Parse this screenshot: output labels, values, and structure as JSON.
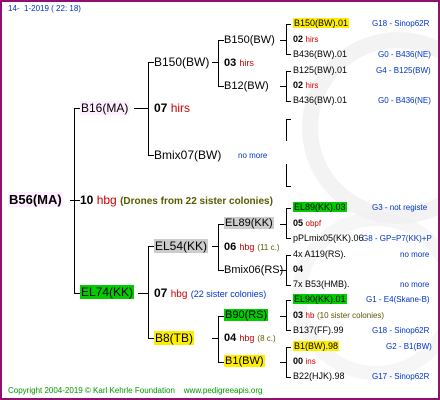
{
  "header": {
    "version": "14-",
    "date": "1-2019",
    "time": "( 22: 18)"
  },
  "root": {
    "name": "B56(MA)",
    "bg": "#ffeeff"
  },
  "gen1": {
    "top": {
      "name": "B16(MA)",
      "bg": "#ffeeff"
    },
    "queen_num": "10",
    "queen_code": "hbg",
    "drones_note": "(Drones from 22 sister colonies)",
    "bottom": {
      "name": "EL74(KK)",
      "bg": "#00cc00"
    }
  },
  "gen2": {
    "b16": {
      "name": "B150(BW)",
      "num": "07",
      "code": "hirs"
    },
    "b16_low": {
      "name": "Bmix07(BW)",
      "note": "no more"
    },
    "el74_top": {
      "name": "EL54(KK)",
      "bg": "#cccccc"
    },
    "el74": {
      "num": "07",
      "code": "hbg",
      "note": "(22 sister colonies)"
    },
    "el74_low": {
      "name": "B8(TB)",
      "bg": "#ffee00"
    }
  },
  "gen3": {
    "b150_top": {
      "name": "B150(BW)",
      "num": "03",
      "code": "hirs"
    },
    "b150_low": {
      "name": "B12(BW)"
    },
    "b12_top": {
      "name": "B125(BW)",
      "num": "02",
      "code": "hirs"
    },
    "el54_top": {
      "name": "EL89(KK)",
      "bg": "#cccccc"
    },
    "el54": {
      "num": "06",
      "code": "hbg",
      "note": "(11 c.)"
    },
    "el54_low": {
      "name": "Bmix06(RS)"
    },
    "b8_top": {
      "name": "B90(RS)",
      "bg": "#00cc00"
    },
    "b8": {
      "num": "04",
      "code": "hbg",
      "note": "(8 c.)"
    },
    "b8_low": {
      "name": "B1(BW)",
      "bg": "#ffee00"
    }
  },
  "gen4": [
    {
      "label": "B150(BW).01",
      "bg": "#ffee00",
      "right": "G18 - Sinop62R"
    },
    {
      "label": "02",
      "code": "hirs"
    },
    {
      "label": "B436(BW).01",
      "right": "G0 - B436(NE)"
    },
    {
      "label": "B125(BW).01",
      "right": "G4 - B125(BW)"
    },
    {
      "label": "02",
      "code": "hirs"
    },
    {
      "label": "B436(BW).01",
      "right": "G0 - B436(NE)"
    },
    {
      "label": "EL89(KK).03",
      "bg": "#00cc00",
      "right": "G3 - not registe"
    },
    {
      "label": "05",
      "code": "obpf"
    },
    {
      "label": "pPLmix05(KK).06",
      "right": "G8 - GP=P7(KK)+P"
    },
    {
      "label": "4x A119(RS).",
      "right": "no more"
    },
    {
      "label": "04"
    },
    {
      "label": "7x B53(HMB).",
      "right": "no more"
    },
    {
      "label": "EL90(KK).01",
      "bg": "#00cc00",
      "right": "G1 - E4(Skane-B)"
    },
    {
      "label": "03",
      "code": "hb",
      "extra": "(10 sister colonies)"
    },
    {
      "label": "B137(FF).99",
      "right": "G18 - Sinop62R"
    },
    {
      "label": "B1(BW).98",
      "bg": "#ffee00",
      "right": "G2 - B1(BW)"
    },
    {
      "label": "00",
      "code": "ins"
    },
    {
      "label": "B22(HJK).98",
      "right": "G17 - Sinop62R"
    }
  ],
  "mid_nomore": "no more",
  "footer": {
    "copyright": "Copyright 2004-2019 © Karl Kehrle Foundation",
    "site": "www.pedigreeapis.org"
  }
}
